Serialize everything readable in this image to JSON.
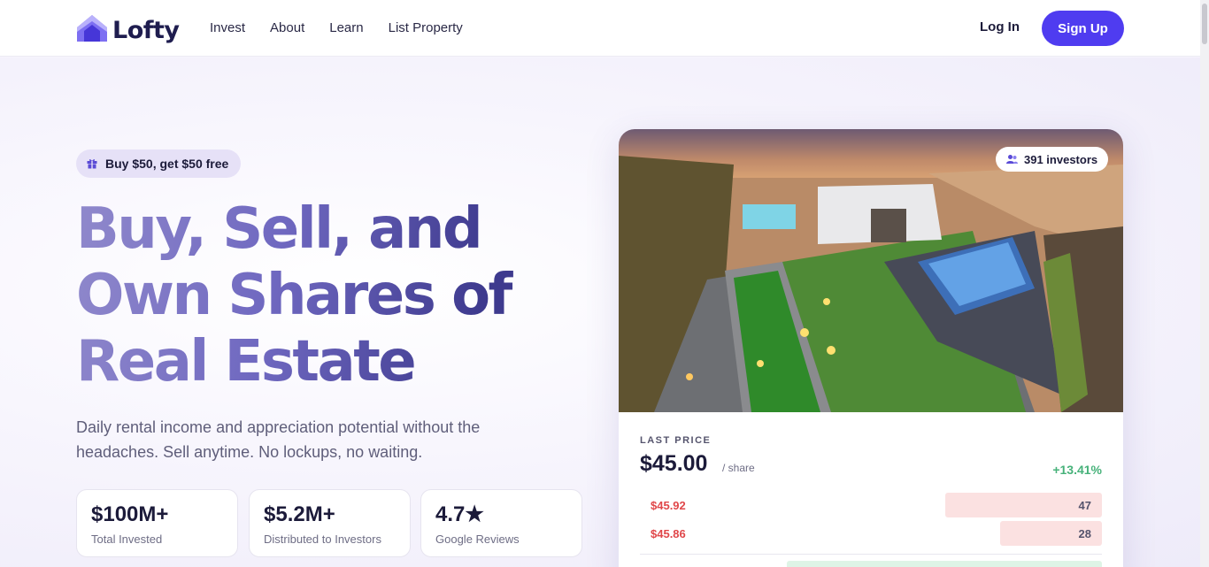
{
  "header": {
    "logo_text": "Lofty",
    "nav": [
      "Invest",
      "About",
      "Learn",
      "List Property"
    ],
    "login": "Log In",
    "signup": "Sign Up"
  },
  "hero": {
    "promo": "Buy $50, get $50 free",
    "headline": "Buy, Sell, and Own Shares of Real Estate",
    "subtitle": "Daily rental income and appreciation potential without the headaches. Sell anytime. No lockups, no waiting.",
    "stats": [
      {
        "value": "$100M+",
        "label": "Total Invested"
      },
      {
        "value": "$5.2M+",
        "label": "Distributed to Investors"
      },
      {
        "value": "4.7★",
        "label": "Google Reviews"
      }
    ]
  },
  "property_card": {
    "investors_badge": "391 investors",
    "last_price_label": "LAST PRICE",
    "price": "$45.00",
    "per_share": "/ share",
    "change": "+13.41%",
    "order_book": {
      "asks": [
        {
          "price": "$45.92",
          "size": "47",
          "depth": 0.34
        },
        {
          "price": "$45.86",
          "size": "28",
          "depth": 0.22
        }
      ],
      "bid_depth": 0.68
    }
  },
  "colors": {
    "brand": "#4f3cf0",
    "ask_red": "#e0474a",
    "gain_green": "#47b27a"
  },
  "icons": [
    "logo-house-icon",
    "gift-icon",
    "users-icon"
  ]
}
